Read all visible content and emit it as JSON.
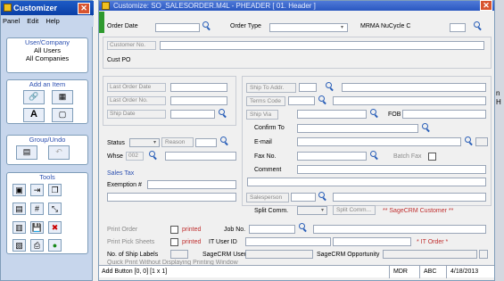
{
  "panel": {
    "title": "Customizer",
    "menu": [
      "Panel",
      "Edit",
      "Help"
    ],
    "user_company": {
      "title": "User/Company",
      "lines": [
        "All Users",
        "All Companies"
      ]
    },
    "add_item": {
      "title": "Add an Item"
    },
    "group_undo": {
      "title": "Group/Undo"
    },
    "tools": {
      "title": "Tools"
    }
  },
  "window": {
    "title": "Customize: SO_SALESORDER.M4L - PHEADER  [ 01. Header ]"
  },
  "form": {
    "order_date": "Order Date",
    "order_type": "Order Type",
    "mrma": "MRMA NuCycle C",
    "customer_no": "Customer No.",
    "cust_po": "Cust PO",
    "last_order_date": "Last Order Date",
    "last_order_no": "Last Order No.",
    "ship_date": "Ship Date",
    "ship_to_addr": "Ship To Addr.",
    "terms_code": "Terms Code",
    "ship_via": "Ship Via",
    "fob": "FOB",
    "confirm_to": "Confirm To",
    "email": "E-mail",
    "fax_no": "Fax No.",
    "batch_fax": "Batch Fax",
    "comment": "Comment",
    "status": "Status",
    "reason": "Reason",
    "whse": "Whse",
    "whse_value": "002",
    "sales_tax": "Sales Tax",
    "exemption": "Exemption #",
    "salesperson": "Salesperson",
    "split_comm": "Split Comm.",
    "split_comm_btn": "Split Comm...",
    "sagecrm_customer": "** SageCRM Customer **",
    "print_order": "Print Order",
    "printed1": "printed",
    "job_no": "Job No.",
    "print_pick": "Print Pick Sheets",
    "printed2": "printed",
    "it_user": "IT User ID",
    "it_order": "* IT Order *",
    "ship_labels": "No. of Ship Labels",
    "sagecrm_user": "SageCRM User",
    "sagecrm_opp": "SageCRM Opportunity",
    "quick_print": "Quick Print Without Displaying Printing Window"
  },
  "status": {
    "add_button": "Add Button  [0, 0]  [1 x 1]",
    "company": "MDR",
    "abc": "ABC",
    "date": "4/18/2013"
  },
  "side_text": [
    "n",
    "H"
  ]
}
